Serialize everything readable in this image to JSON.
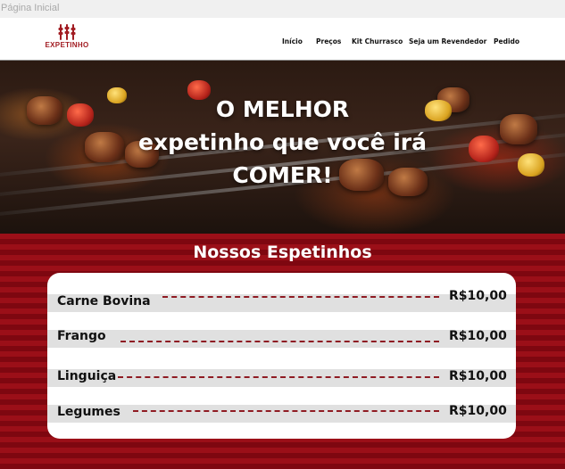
{
  "browser": {
    "tab_title": "Página Inicial"
  },
  "brand": {
    "name": "EXPETINHO",
    "color": "#a21d23"
  },
  "nav": {
    "items": [
      {
        "label": "Início"
      },
      {
        "label": "Preços"
      },
      {
        "label": "Kit Churrasco"
      },
      {
        "label": "Seja um Revendedor"
      },
      {
        "label": "Pedido"
      }
    ]
  },
  "hero": {
    "lines": [
      "O MELHOR",
      "expetinho que você irá",
      "COMER!"
    ]
  },
  "menu": {
    "title": "Nossos Espetinhos",
    "items": [
      {
        "name": "Carne Bovina",
        "price": "R$10,00"
      },
      {
        "name": "Frango",
        "price": "R$10,00"
      },
      {
        "name": "Linguiça",
        "price": "R$10,00"
      },
      {
        "name": "Legumes",
        "price": "R$10,00"
      }
    ]
  },
  "colors": {
    "menu_background": "#9b0f18",
    "dotted_leader": "#8f1b23"
  }
}
